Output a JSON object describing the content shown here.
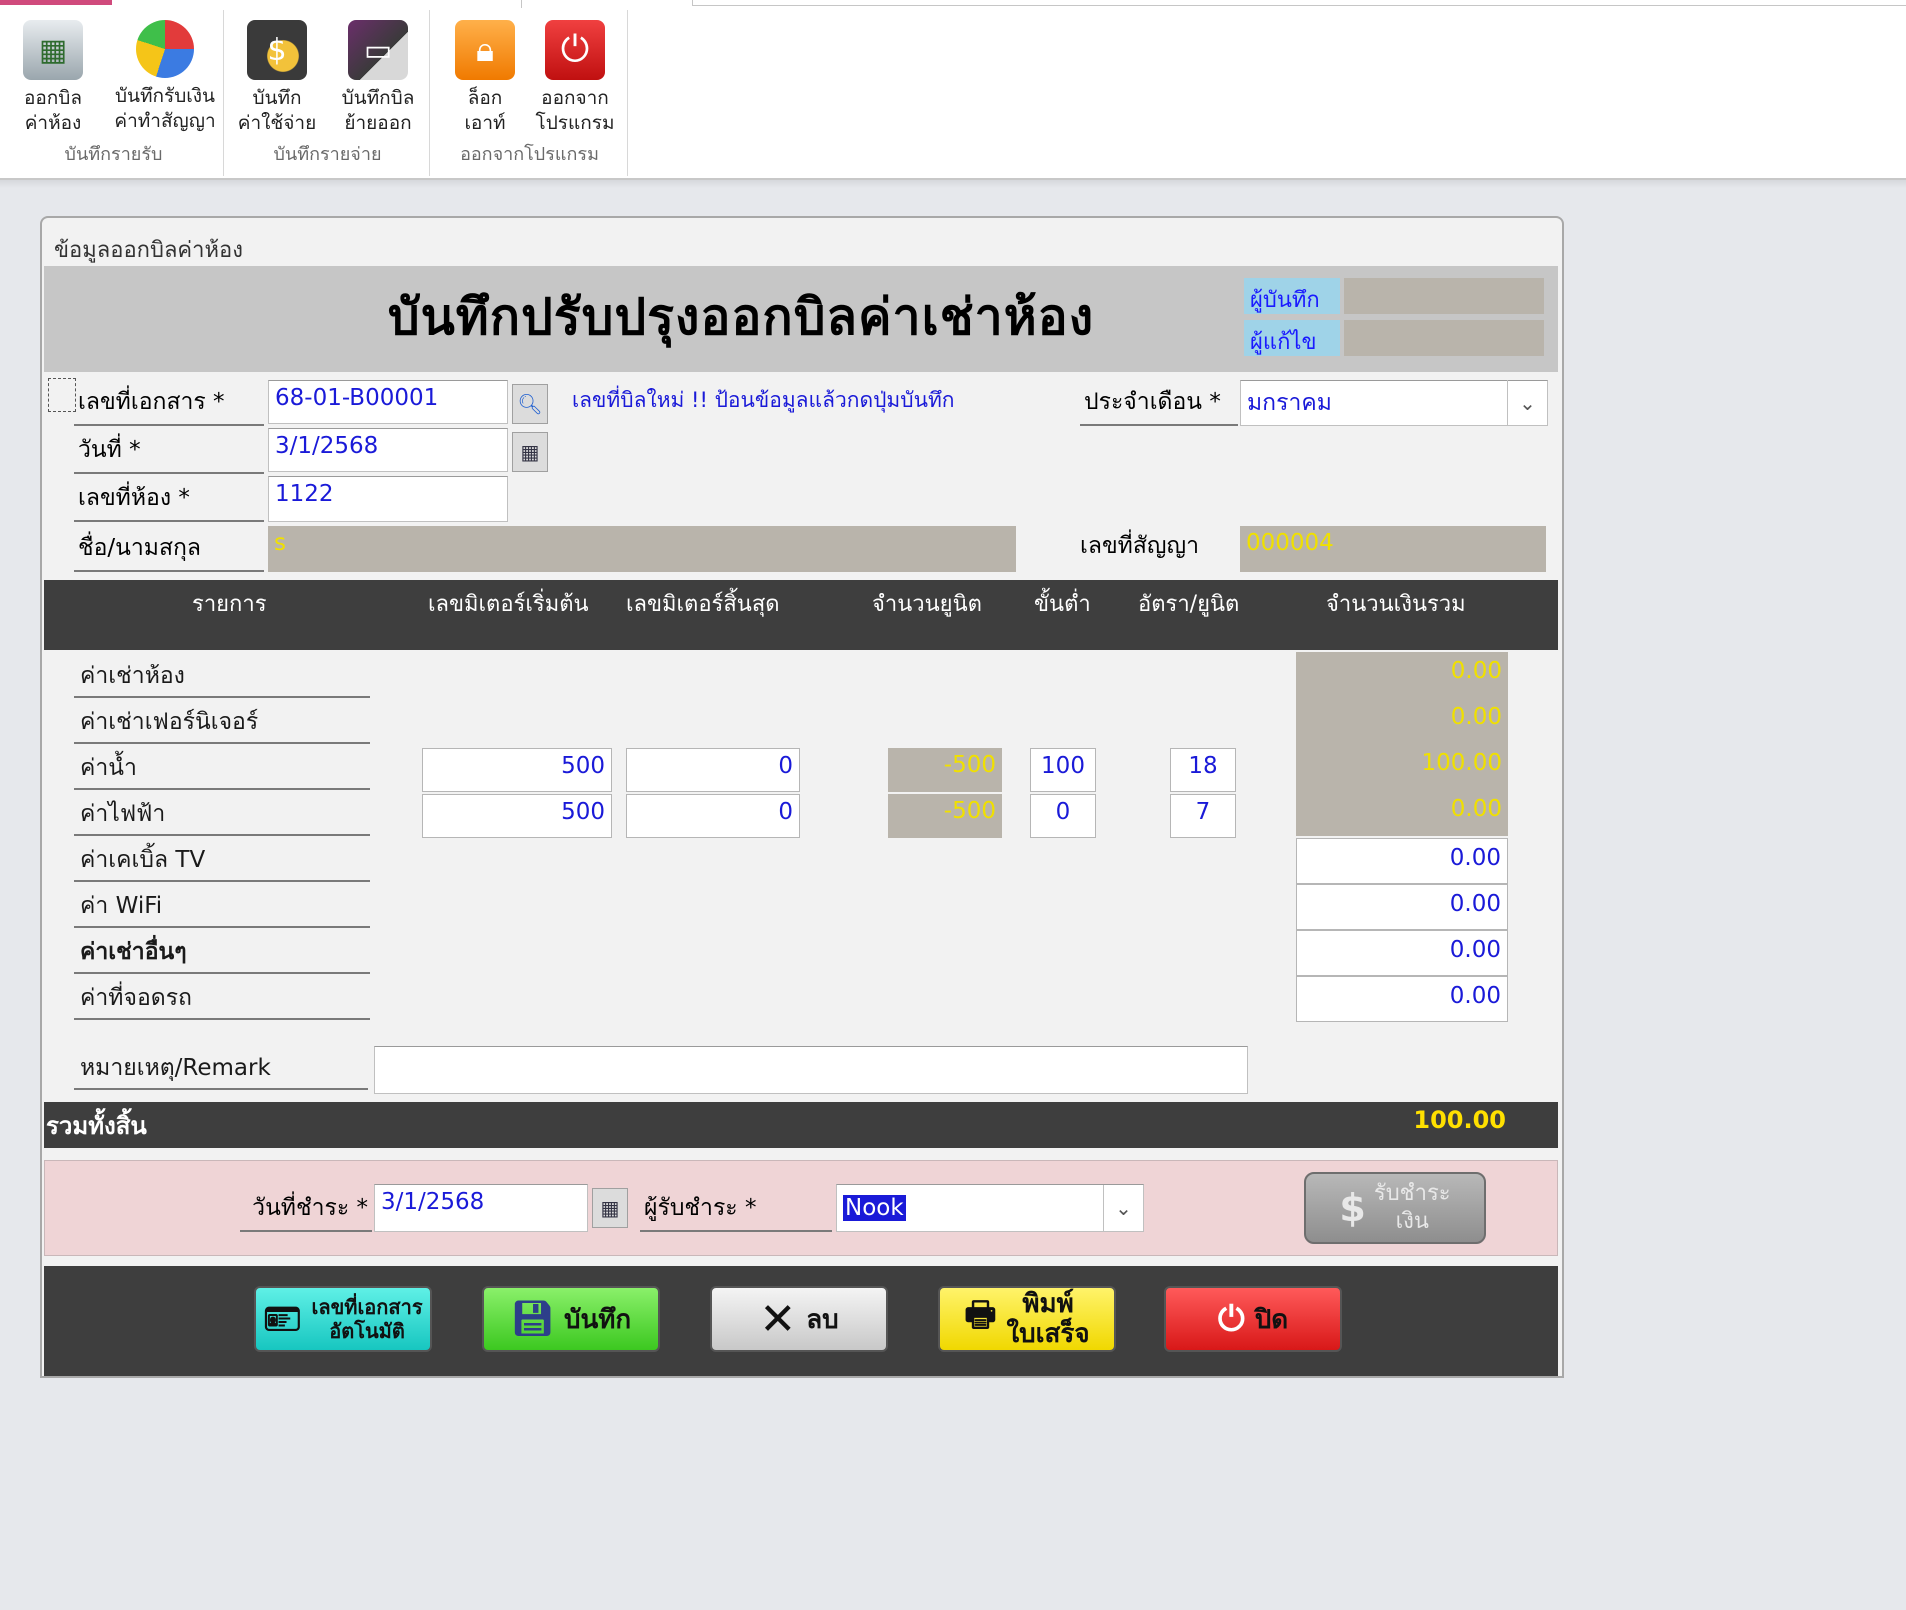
{
  "ribbon": {
    "groups": [
      {
        "label": "บันทึกรายรับ",
        "buttons": [
          {
            "label": "ออกบิล\nค่าห้อง",
            "icon": "bill-calculator-icon"
          },
          {
            "label": "บันทึกรับเงิน\nค่าทำสัญญา",
            "icon": "pie-chart-icon"
          }
        ]
      },
      {
        "label": "บันทึกรายจ่าย",
        "buttons": [
          {
            "label": "บันทึก\nค่าใช้จ่าย",
            "icon": "wallet-coin-icon"
          },
          {
            "label": "บันทึกบิล\nย้ายออก",
            "icon": "card-reader-icon"
          }
        ]
      },
      {
        "label": "ออกจากโปรแกรม",
        "buttons": [
          {
            "label": "ล็อก\nเอาท์",
            "icon": "lock-icon"
          },
          {
            "label": "ออกจาก\nโปรแกรม",
            "icon": "power-icon"
          }
        ]
      }
    ]
  },
  "form": {
    "caption": "ข้อมูลออกบิลค่าห้อง",
    "title": "บันทึกปรับปรุงออกบิลค่าเช่าห้อง",
    "recorder_label": "ผู้บันทึก",
    "editor_label": "ผู้แก้ไข",
    "doc_no_label": "เลขที่เอกสาร *",
    "doc_no": "68-01-B00001",
    "new_bill_note": "เลขที่บิลใหม่ !! ป้อนข้อมูลแล้วกดปุ่มบันทึก",
    "month_label": "ประจำเดือน *",
    "month": "มกราคม",
    "date_label": "วันที่ *",
    "date": "3/1/2568",
    "room_label": "เลขที่ห้อง *",
    "room": "1122",
    "name_label": "ชื่อ/นามสกุล",
    "name": "s",
    "contract_label": "เลขที่สัญญา",
    "contract": "000004"
  },
  "grid": {
    "headers": [
      "รายการ",
      "เลขมิเตอร์เริ่มต้น",
      "เลขมิเตอร์สิ้นสุด",
      "จำนวนยูนิต",
      "ขั้นต่ำ",
      "อัตรา/ยูนิต",
      "จำนวนเงินรวม"
    ],
    "rows": [
      {
        "label": "ค่าเช่าห้อง",
        "total": "0.00"
      },
      {
        "label": "ค่าเช่าเฟอร์นิเจอร์",
        "total": "0.00"
      },
      {
        "label": "ค่าน้ำ",
        "meter_start": "500",
        "meter_end": "0",
        "units": "-500",
        "minimum": "100",
        "rate": "18",
        "total": "100.00"
      },
      {
        "label": "ค่าไฟฟ้า",
        "meter_start": "500",
        "meter_end": "0",
        "units": "-500",
        "minimum": "0",
        "rate": "7",
        "total": "0.00"
      },
      {
        "label": "ค่าเคเบิ้ล TV",
        "total": "0.00"
      },
      {
        "label": "ค่า WiFi",
        "total": "0.00"
      },
      {
        "label": "ค่าเช่าอื่นๆ",
        "total": "0.00"
      },
      {
        "label": "ค่าที่จอดรถ",
        "total": "0.00"
      }
    ],
    "remark_label": "หมายเหตุ/Remark",
    "remark": ""
  },
  "summary": {
    "label": "รวมทั้งสิ้น",
    "value": "100.00"
  },
  "payment": {
    "date_label": "วันที่ชำระ *",
    "date": "3/1/2568",
    "receiver_label": "ผู้รับชำระ *",
    "receiver": "Nook",
    "receive_button": "รับชำระ\nเงิน"
  },
  "buttons": {
    "auto_doc": "เลขที่เอกสาร\nอัตโนมัติ",
    "save": "บันทึก",
    "delete": "ลบ",
    "print": "พิมพ์\nใบเสร็จ",
    "close": "ปิด"
  },
  "colors": {
    "dark_band": "#3e3e3e",
    "readonly_bg": "#b9b4ab",
    "readonly_text": "#f0e000",
    "value_text": "#1a1ad8",
    "pay_band": "#efd4d6"
  }
}
